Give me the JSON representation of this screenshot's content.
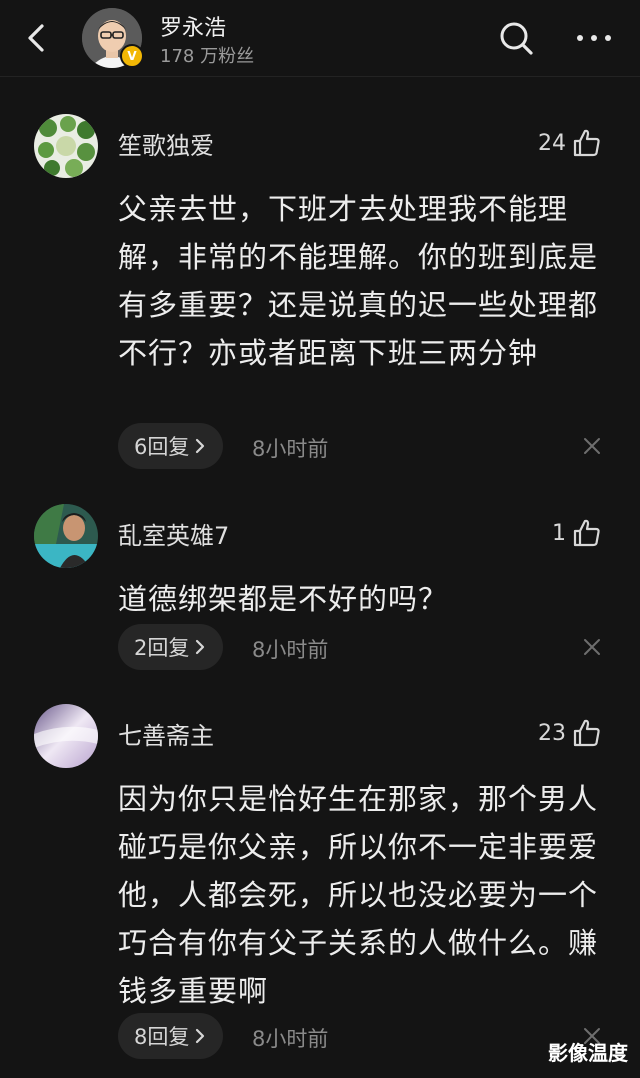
{
  "header": {
    "name": "罗永浩",
    "fans": "178 万粉丝",
    "verified_mark": "V"
  },
  "icons": {
    "back": "chevron-left-icon",
    "search": "search-icon",
    "more": "more-horizontal-icon",
    "like": "thumbs-up-icon",
    "reply_arrow": "chevron-right-icon",
    "close": "close-icon"
  },
  "comments": [
    {
      "name": "笙歌独爱",
      "likes": "24",
      "text": "父亲去世，下班才去处理我不能理解，非常的不能理解。你的班到底是有多重要？还是说真的迟一些处理都不行？亦或者距离下班三两分钟",
      "replies": "6回复",
      "time": "8小时前"
    },
    {
      "name": "乱室英雄7",
      "likes": "1",
      "text": "道德绑架都是不好的吗？",
      "replies": "2回复",
      "time": "8小时前"
    },
    {
      "name": "七善斋主",
      "likes": "23",
      "text": "因为你只是恰好生在那家，那个男人碰巧是你父亲，所以你不一定非要爱他，人都会死，所以也没必要为一个巧合有你有父子关系的人做什么。赚钱多重要啊",
      "replies": "8回复",
      "time": "8小时前"
    }
  ],
  "watermark": "影像温度",
  "colors": {
    "background": "#141414",
    "pill": "#262626",
    "text": "#ededed",
    "secondary": "#8a8a8a",
    "verified": "#f2b705"
  }
}
